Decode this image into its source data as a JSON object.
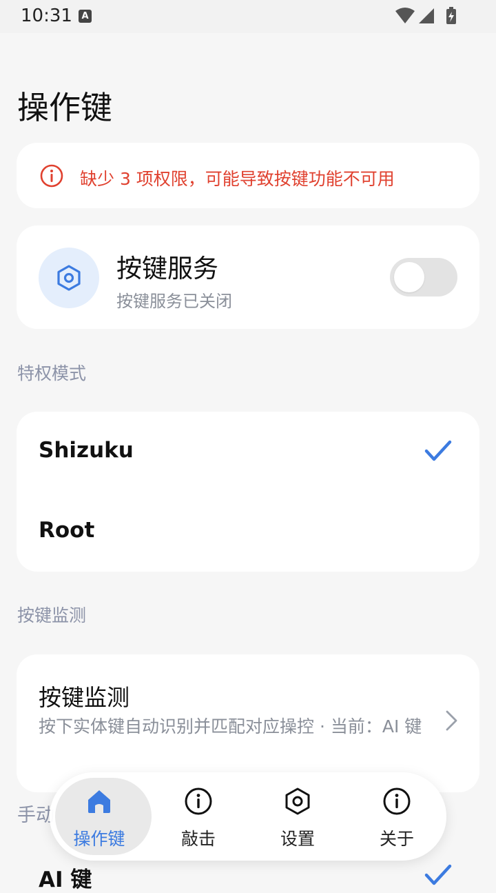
{
  "status_bar": {
    "time": "10:31",
    "notification_icon": "A",
    "icons": [
      "wifi-icon",
      "signal-icon",
      "battery-charging-icon"
    ]
  },
  "page": {
    "title": "操作键"
  },
  "warning": {
    "text": "缺少 3 项权限，可能导致按键功能不可用",
    "color": "#e0412f"
  },
  "service": {
    "title": "按键服务",
    "subtitle": "按键服务已关闭",
    "enabled": false
  },
  "privilege": {
    "section_label": "特权模式",
    "options": [
      {
        "label": "Shizuku",
        "selected": true
      },
      {
        "label": "Root",
        "selected": false
      }
    ]
  },
  "monitor": {
    "section_label": "按键监测",
    "title": "按键监测",
    "description": "按下实体键自动识别并匹配对应操控 · 当前：AI 键"
  },
  "manual": {
    "section_label": "手动",
    "item_label": "AI 键",
    "item_selected": true
  },
  "bottom_nav": {
    "items": [
      {
        "label": "操作键",
        "icon": "home-icon",
        "active": true
      },
      {
        "label": "敲击",
        "icon": "info-icon",
        "active": false
      },
      {
        "label": "设置",
        "icon": "settings-icon",
        "active": false
      },
      {
        "label": "关于",
        "icon": "info-icon",
        "active": false
      }
    ]
  },
  "colors": {
    "accent": "#3c7be0",
    "warning": "#e0412f",
    "background": "#f6f6f6"
  }
}
